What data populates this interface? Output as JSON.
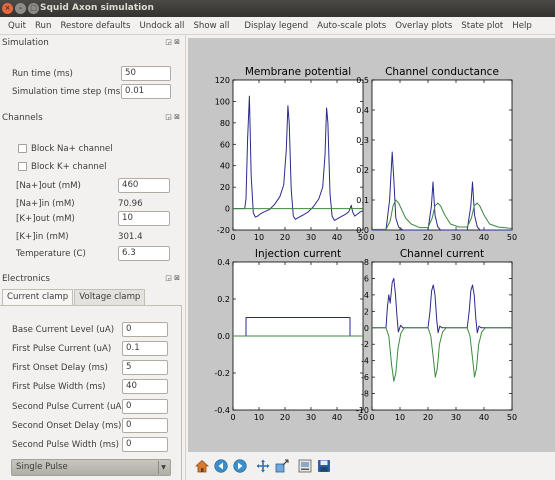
{
  "window": {
    "title": "Squid Axon simulation"
  },
  "menu": [
    "Quit",
    "Run",
    "Restore defaults",
    "Undock all",
    "Show all",
    "Display legend",
    "Auto-scale plots",
    "Overlay plots",
    "State plot",
    "Help"
  ],
  "simulation": {
    "title": "Simulation",
    "run_time_label": "Run time (ms)",
    "run_time": "50",
    "timestep_label": "Simulation time step (ms)",
    "timestep": "0.01"
  },
  "channels": {
    "title": "Channels",
    "block_na": "Block Na+ channel",
    "block_k": "Block K+ channel",
    "na_out_label": "[Na+]out (mM)",
    "na_out": "460",
    "na_in_label": "[Na+]in (mM)",
    "na_in": "70.96",
    "k_out_label": "[K+]out (mM)",
    "k_out": "10",
    "k_in_label": "[K+]in (mM)",
    "k_in": "301.4",
    "temp_label": "Temperature (C)",
    "temp": "6.3"
  },
  "electronics": {
    "title": "Electronics",
    "tab_current": "Current clamp",
    "tab_voltage": "Voltage clamp",
    "fields": [
      {
        "label": "Base Current Level (uA)",
        "value": "0"
      },
      {
        "label": "First Pulse Current (uA)",
        "value": "0.1"
      },
      {
        "label": "First Onset Delay (ms)",
        "value": "5"
      },
      {
        "label": "First Pulse Width (ms)",
        "value": "40"
      },
      {
        "label": "Second Pulse Current (uA)",
        "value": "0"
      },
      {
        "label": "Second Onset Delay (ms)",
        "value": "0"
      },
      {
        "label": "Second Pulse Width (ms)",
        "value": "0"
      }
    ],
    "pulse_mode": "Single Pulse"
  },
  "toolbar_icons": [
    "home-icon",
    "back-icon",
    "forward-icon",
    "pan-icon",
    "zoom-icon",
    "configure-icon",
    "save-icon"
  ],
  "colors": {
    "trace_primary": "#2a2a8c",
    "trace_secondary": "#3d8a3d",
    "plot_bg": "#c6c6c6"
  },
  "chart_data": [
    {
      "type": "line",
      "title": "Membrane potential",
      "xlim": [
        0,
        50
      ],
      "ylim": [
        -20,
        120
      ],
      "xticks": [
        0,
        10,
        20,
        30,
        40,
        50
      ],
      "yticks": [
        -20,
        0,
        20,
        40,
        60,
        80,
        100,
        120
      ],
      "series": [
        {
          "x": [
            0,
            4.5,
            5,
            5.6,
            6.3,
            7.0,
            7.8,
            8.6,
            9.5,
            10.5,
            12,
            14,
            16,
            18,
            19.5,
            20.5,
            21.1,
            21.6,
            22.4,
            23.2,
            24,
            25.5,
            27,
            29,
            31,
            33,
            34.5,
            35.4,
            36,
            36.5,
            37.3,
            38.1,
            39,
            40.5,
            42,
            43.5,
            44.5,
            45.5,
            46,
            46.8,
            48,
            49,
            50
          ],
          "y": [
            0,
            0,
            9,
            65,
            105,
            30,
            -4,
            -8,
            -7,
            -5,
            -3,
            -1,
            4,
            11,
            22,
            55,
            96,
            80,
            18,
            -7,
            -10,
            -8,
            -6,
            -3,
            2,
            9,
            20,
            50,
            94,
            80,
            14,
            -7,
            -11,
            -9,
            -7,
            -5,
            -3,
            3,
            -3,
            -7,
            -5,
            -3,
            -2
          ]
        },
        {
          "x": [
            0,
            50
          ],
          "y": [
            0,
            0
          ]
        }
      ]
    },
    {
      "type": "line",
      "title": "Channel conductance",
      "xlim": [
        0,
        50
      ],
      "ylim": [
        0,
        0.5
      ],
      "xticks": [
        0,
        10,
        20,
        30,
        40,
        50
      ],
      "yticks": [
        0.0,
        0.1,
        0.2,
        0.3,
        0.4,
        0.5
      ],
      "series": [
        {
          "x": [
            0,
            5,
            6.3,
            7.2,
            7.8,
            8.5,
            9.5,
            11,
            20,
            21.2,
            21.8,
            22.5,
            23.5,
            24.5,
            34,
            35.3,
            35.9,
            36.6,
            37.6,
            38.6,
            50
          ],
          "y": [
            0,
            0,
            0.1,
            0.26,
            0.17,
            0.04,
            0.01,
            0,
            0,
            0.08,
            0.16,
            0.05,
            0.01,
            0,
            0,
            0.08,
            0.16,
            0.05,
            0.01,
            0,
            0
          ]
        },
        {
          "x": [
            0,
            5,
            6.5,
            7.5,
            8.5,
            9.5,
            10.5,
            12,
            14,
            17,
            20,
            21.5,
            22.5,
            23.5,
            24.5,
            26,
            28,
            31,
            34,
            35.5,
            36.5,
            37.5,
            38.5,
            40,
            42,
            45,
            50
          ],
          "y": [
            0.002,
            0.002,
            0.03,
            0.08,
            0.1,
            0.09,
            0.07,
            0.04,
            0.02,
            0.008,
            0.008,
            0.04,
            0.08,
            0.09,
            0.08,
            0.05,
            0.02,
            0.01,
            0.01,
            0.04,
            0.08,
            0.09,
            0.08,
            0.05,
            0.02,
            0.01,
            0.005
          ]
        }
      ]
    },
    {
      "type": "line",
      "title": "Injection current",
      "xlim": [
        0,
        50
      ],
      "ylim": [
        -0.4,
        0.4
      ],
      "xticks": [
        0,
        10,
        20,
        30,
        40,
        50
      ],
      "yticks": [
        -0.4,
        -0.2,
        0.0,
        0.2,
        0.4
      ],
      "series": [
        {
          "x": [
            0,
            5,
            5,
            45,
            45,
            50
          ],
          "y": [
            0,
            0,
            0.1,
            0.1,
            0,
            0
          ]
        },
        {
          "x": [
            0,
            50
          ],
          "y": [
            0,
            0
          ]
        }
      ]
    },
    {
      "type": "line",
      "title": "Channel current",
      "xlim": [
        0,
        50
      ],
      "ylim": [
        -10,
        8
      ],
      "xticks": [
        0,
        10,
        20,
        30,
        40,
        50
      ],
      "yticks": [
        -10,
        -8,
        -6,
        -4,
        -2,
        0,
        2,
        4,
        6,
        8
      ],
      "series": [
        {
          "x": [
            0,
            5,
            5.5,
            6,
            6.5,
            7.2,
            7.8,
            8.4,
            8.9,
            9.4,
            10.2,
            11,
            20,
            20.7,
            21.3,
            21.9,
            22.5,
            23.1,
            23.6,
            24.2,
            25,
            34,
            34.7,
            35.3,
            35.9,
            36.5,
            37.1,
            37.6,
            38.2,
            39,
            50
          ],
          "y": [
            0,
            0,
            2.5,
            4,
            3,
            5.5,
            6,
            4,
            1.5,
            -0.5,
            0.3,
            0,
            0,
            2,
            4.5,
            5.2,
            4,
            1,
            -0.6,
            0.2,
            0,
            0,
            2,
            4.5,
            5.2,
            4,
            1,
            -0.6,
            0.2,
            0,
            0
          ]
        },
        {
          "x": [
            0,
            5,
            6,
            7,
            7.8,
            8.5,
            9.3,
            10.3,
            11.5,
            20,
            21,
            22,
            22.6,
            23.3,
            24.1,
            25.2,
            26.5,
            34,
            35,
            36,
            36.6,
            37.3,
            38.1,
            39.2,
            40.5,
            50
          ],
          "y": [
            0,
            0,
            -1,
            -4.5,
            -6.5,
            -5.5,
            -2.5,
            -0.7,
            0,
            0,
            -1,
            -4,
            -6,
            -5,
            -2,
            -0.5,
            0,
            0,
            -1,
            -4,
            -6,
            -5,
            -2,
            -0.5,
            0,
            0
          ]
        }
      ]
    }
  ]
}
